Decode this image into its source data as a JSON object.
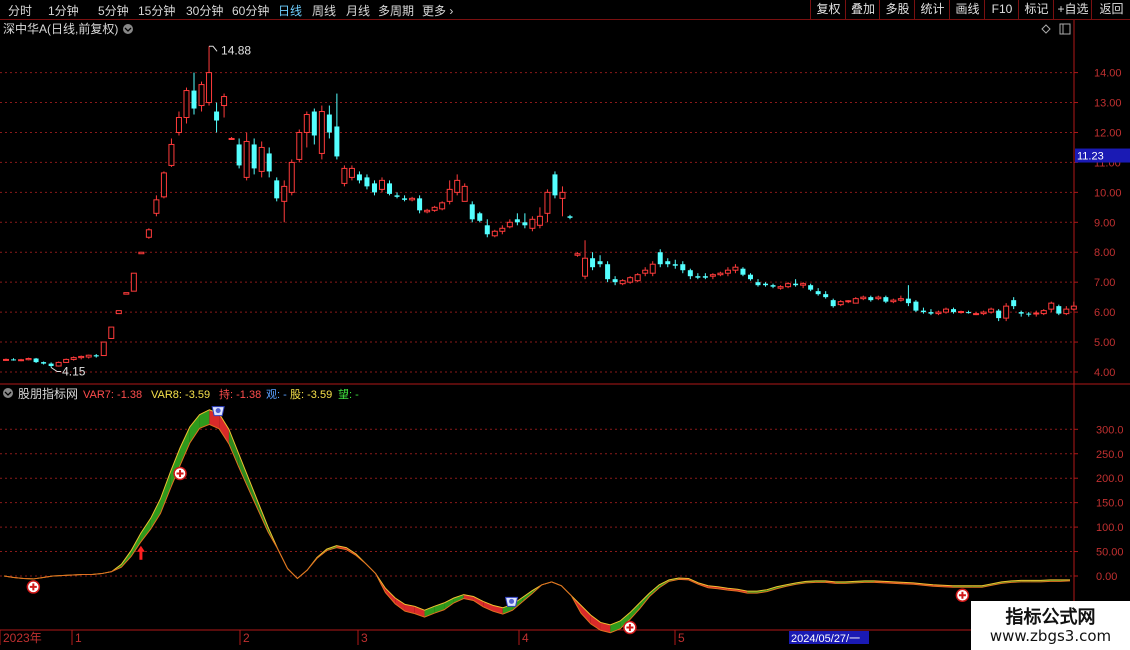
{
  "toolbar": {
    "periods": [
      "分时",
      "1分钟",
      "5分钟",
      "15分钟",
      "30分钟",
      "60分钟",
      "日线",
      "周线",
      "月线",
      "多周期",
      "更多"
    ],
    "active_period": "日线",
    "right_buttons": [
      "复权",
      "叠加",
      "多股",
      "统计",
      "画线",
      "F10",
      "标记",
      "+自选",
      "返回"
    ]
  },
  "main_chart": {
    "title": "深中华A(日线,前复权)",
    "high_label": "14.88",
    "low_label": "4.15",
    "current_price": "11.23",
    "y_ticks": [
      "14.00",
      "13.00",
      "12.00",
      "11.00",
      "10.00",
      "9.00",
      "8.00",
      "7.00",
      "6.00",
      "5.00",
      "4.00"
    ]
  },
  "indicator": {
    "name": "股朋指标网",
    "legend": [
      {
        "key": "VAR7",
        "value": "-1.38",
        "color": "#ff4d4d"
      },
      {
        "key": "VAR8",
        "value": "-3.59",
        "color": "#f5e04a"
      },
      {
        "key": "持",
        "value": "-1.38",
        "color": "#ff4d4d"
      },
      {
        "key": "观",
        "value": "-",
        "color": "#5aa0ff"
      },
      {
        "key": "股",
        "value": "-3.59",
        "color": "#f5e04a"
      },
      {
        "key": "望",
        "value": "-",
        "color": "#3ee03e"
      }
    ],
    "y_ticks": [
      "300.0",
      "250.0",
      "200.0",
      "150.0",
      "100.0",
      "50.00",
      "0.00"
    ]
  },
  "x_axis": {
    "labels": [
      "2023年",
      "1",
      "2",
      "3",
      "4",
      "5"
    ],
    "date_box": "2024/05/27/一"
  },
  "watermark": {
    "line1": "指标公式网",
    "line2": "www.zbgs3.com"
  },
  "colors": {
    "up": "#ff3b3b",
    "down": "#54ffff",
    "grid": "#8a1a1a",
    "axis": "#b01818"
  },
  "chart_data": {
    "type": "candlestick",
    "price_ylim": [
      3.8,
      15.0
    ],
    "indicator_ylim": [
      -105,
      360
    ],
    "candles": [
      {
        "i": 0,
        "o": 4.4,
        "h": 4.45,
        "l": 4.38,
        "c": 4.42
      },
      {
        "i": 1,
        "o": 4.42,
        "h": 4.46,
        "l": 4.38,
        "c": 4.4
      },
      {
        "i": 2,
        "o": 4.4,
        "h": 4.44,
        "l": 4.36,
        "c": 4.41
      },
      {
        "i": 3,
        "o": 4.41,
        "h": 4.48,
        "l": 4.39,
        "c": 4.45
      },
      {
        "i": 4,
        "o": 4.45,
        "h": 4.47,
        "l": 4.3,
        "c": 4.33
      },
      {
        "i": 5,
        "o": 4.33,
        "h": 4.35,
        "l": 4.25,
        "c": 4.28
      },
      {
        "i": 6,
        "o": 4.28,
        "h": 4.32,
        "l": 4.15,
        "c": 4.2
      },
      {
        "i": 7,
        "o": 4.2,
        "h": 4.35,
        "l": 4.18,
        "c": 4.32
      },
      {
        "i": 8,
        "o": 4.32,
        "h": 4.45,
        "l": 4.3,
        "c": 4.42
      },
      {
        "i": 9,
        "o": 4.42,
        "h": 4.52,
        "l": 4.38,
        "c": 4.48
      },
      {
        "i": 10,
        "o": 4.48,
        "h": 4.55,
        "l": 4.42,
        "c": 4.52
      },
      {
        "i": 11,
        "o": 4.5,
        "h": 4.58,
        "l": 4.45,
        "c": 4.56
      },
      {
        "i": 12,
        "o": 4.56,
        "h": 4.6,
        "l": 4.48,
        "c": 4.52
      },
      {
        "i": 13,
        "o": 4.55,
        "h": 5.0,
        "l": 4.55,
        "c": 5.0
      },
      {
        "i": 14,
        "o": 5.12,
        "h": 5.5,
        "l": 5.12,
        "c": 5.5
      },
      {
        "i": 15,
        "o": 5.95,
        "h": 6.05,
        "l": 5.95,
        "c": 6.05
      },
      {
        "i": 16,
        "o": 6.6,
        "h": 6.65,
        "l": 6.6,
        "c": 6.65
      },
      {
        "i": 17,
        "o": 6.7,
        "h": 7.3,
        "l": 6.7,
        "c": 7.3
      },
      {
        "i": 18,
        "o": 7.95,
        "h": 8.0,
        "l": 7.95,
        "c": 8.0
      },
      {
        "i": 19,
        "o": 8.5,
        "h": 8.8,
        "l": 8.45,
        "c": 8.75
      },
      {
        "i": 20,
        "o": 9.3,
        "h": 9.9,
        "l": 9.2,
        "c": 9.75
      },
      {
        "i": 21,
        "o": 9.85,
        "h": 10.7,
        "l": 9.8,
        "c": 10.65
      },
      {
        "i": 22,
        "o": 10.9,
        "h": 11.8,
        "l": 10.85,
        "c": 11.6
      },
      {
        "i": 23,
        "o": 12.0,
        "h": 12.7,
        "l": 11.9,
        "c": 12.5
      },
      {
        "i": 24,
        "o": 12.5,
        "h": 13.5,
        "l": 12.3,
        "c": 13.4
      },
      {
        "i": 25,
        "o": 13.4,
        "h": 14.0,
        "l": 12.6,
        "c": 12.8
      },
      {
        "i": 26,
        "o": 12.9,
        "h": 13.7,
        "l": 12.7,
        "c": 13.6
      },
      {
        "i": 27,
        "o": 13.0,
        "h": 14.88,
        "l": 12.9,
        "c": 14.0
      },
      {
        "i": 28,
        "o": 12.7,
        "h": 13.0,
        "l": 12.0,
        "c": 12.4
      },
      {
        "i": 29,
        "o": 12.9,
        "h": 13.3,
        "l": 12.5,
        "c": 13.2
      },
      {
        "i": 30,
        "o": 11.8,
        "h": 11.85,
        "l": 11.75,
        "c": 11.8
      },
      {
        "i": 31,
        "o": 11.6,
        "h": 11.8,
        "l": 10.8,
        "c": 10.9
      },
      {
        "i": 32,
        "o": 10.5,
        "h": 12.0,
        "l": 10.4,
        "c": 11.7
      },
      {
        "i": 33,
        "o": 11.6,
        "h": 11.8,
        "l": 10.6,
        "c": 10.8
      },
      {
        "i": 34,
        "o": 10.7,
        "h": 11.7,
        "l": 10.5,
        "c": 11.5
      },
      {
        "i": 35,
        "o": 11.3,
        "h": 11.5,
        "l": 10.5,
        "c": 10.7
      },
      {
        "i": 36,
        "o": 10.4,
        "h": 10.5,
        "l": 9.7,
        "c": 9.8
      },
      {
        "i": 37,
        "o": 9.7,
        "h": 10.4,
        "l": 9.0,
        "c": 10.2
      },
      {
        "i": 38,
        "o": 10.0,
        "h": 11.1,
        "l": 9.9,
        "c": 11.0
      },
      {
        "i": 39,
        "o": 11.1,
        "h": 12.1,
        "l": 11.0,
        "c": 12.0
      },
      {
        "i": 40,
        "o": 12.0,
        "h": 12.7,
        "l": 11.5,
        "c": 12.6
      },
      {
        "i": 41,
        "o": 12.7,
        "h": 12.8,
        "l": 11.6,
        "c": 11.9
      },
      {
        "i": 42,
        "o": 11.3,
        "h": 12.9,
        "l": 11.1,
        "c": 12.7
      },
      {
        "i": 43,
        "o": 12.6,
        "h": 12.9,
        "l": 11.8,
        "c": 12.0
      },
      {
        "i": 44,
        "o": 12.2,
        "h": 13.3,
        "l": 11.1,
        "c": 11.2
      },
      {
        "i": 45,
        "o": 10.3,
        "h": 10.9,
        "l": 10.2,
        "c": 10.8
      },
      {
        "i": 46,
        "o": 10.5,
        "h": 10.9,
        "l": 10.4,
        "c": 10.8
      },
      {
        "i": 47,
        "o": 10.6,
        "h": 10.7,
        "l": 10.3,
        "c": 10.4
      },
      {
        "i": 48,
        "o": 10.5,
        "h": 10.6,
        "l": 10.1,
        "c": 10.2
      },
      {
        "i": 49,
        "o": 10.3,
        "h": 10.4,
        "l": 9.9,
        "c": 10.0
      },
      {
        "i": 50,
        "o": 10.1,
        "h": 10.5,
        "l": 10.0,
        "c": 10.4
      },
      {
        "i": 51,
        "o": 10.3,
        "h": 10.4,
        "l": 9.9,
        "c": 9.95
      },
      {
        "i": 52,
        "o": 9.9,
        "h": 10.0,
        "l": 9.8,
        "c": 9.85
      },
      {
        "i": 53,
        "o": 9.8,
        "h": 9.9,
        "l": 9.7,
        "c": 9.75
      },
      {
        "i": 54,
        "o": 9.75,
        "h": 9.85,
        "l": 9.7,
        "c": 9.8
      },
      {
        "i": 55,
        "o": 9.8,
        "h": 9.9,
        "l": 9.3,
        "c": 9.4
      },
      {
        "i": 56,
        "o": 9.35,
        "h": 9.45,
        "l": 9.3,
        "c": 9.4
      },
      {
        "i": 57,
        "o": 9.4,
        "h": 9.55,
        "l": 9.35,
        "c": 9.5
      },
      {
        "i": 58,
        "o": 9.45,
        "h": 9.7,
        "l": 9.4,
        "c": 9.65
      },
      {
        "i": 59,
        "o": 9.7,
        "h": 10.4,
        "l": 9.6,
        "c": 10.1
      },
      {
        "i": 60,
        "o": 10.0,
        "h": 10.6,
        "l": 9.9,
        "c": 10.4
      },
      {
        "i": 61,
        "o": 9.7,
        "h": 10.3,
        "l": 9.7,
        "c": 10.2
      },
      {
        "i": 62,
        "o": 9.6,
        "h": 9.7,
        "l": 9.0,
        "c": 9.1
      },
      {
        "i": 63,
        "o": 9.3,
        "h": 9.35,
        "l": 9.0,
        "c": 9.05
      },
      {
        "i": 64,
        "o": 8.9,
        "h": 9.1,
        "l": 8.5,
        "c": 8.6
      },
      {
        "i": 65,
        "o": 8.55,
        "h": 8.75,
        "l": 8.5,
        "c": 8.7
      },
      {
        "i": 66,
        "o": 8.7,
        "h": 8.9,
        "l": 8.6,
        "c": 8.8
      },
      {
        "i": 67,
        "o": 8.85,
        "h": 9.1,
        "l": 8.8,
        "c": 9.0
      },
      {
        "i": 68,
        "o": 9.1,
        "h": 9.3,
        "l": 8.9,
        "c": 9.0
      },
      {
        "i": 69,
        "o": 9.0,
        "h": 9.3,
        "l": 8.8,
        "c": 8.9
      },
      {
        "i": 70,
        "o": 8.8,
        "h": 9.2,
        "l": 8.7,
        "c": 9.1
      },
      {
        "i": 71,
        "o": 8.9,
        "h": 9.5,
        "l": 8.8,
        "c": 9.2
      },
      {
        "i": 72,
        "o": 9.3,
        "h": 10.1,
        "l": 9.0,
        "c": 10.0
      },
      {
        "i": 73,
        "o": 10.6,
        "h": 10.7,
        "l": 9.8,
        "c": 9.9
      },
      {
        "i": 74,
        "o": 9.8,
        "h": 10.2,
        "l": 9.2,
        "c": 10.0
      },
      {
        "i": 75,
        "o": 9.2,
        "h": 9.25,
        "l": 9.1,
        "c": 9.15
      },
      {
        "i": 76,
        "o": 7.9,
        "h": 8.0,
        "l": 7.85,
        "c": 7.95
      },
      {
        "i": 77,
        "o": 7.2,
        "h": 8.4,
        "l": 7.1,
        "c": 7.8
      },
      {
        "i": 78,
        "o": 7.8,
        "h": 8.0,
        "l": 7.4,
        "c": 7.5
      },
      {
        "i": 79,
        "o": 7.7,
        "h": 7.9,
        "l": 7.5,
        "c": 7.6
      },
      {
        "i": 80,
        "o": 7.6,
        "h": 7.7,
        "l": 7.0,
        "c": 7.1
      },
      {
        "i": 81,
        "o": 7.1,
        "h": 7.2,
        "l": 6.9,
        "c": 7.0
      },
      {
        "i": 82,
        "o": 6.95,
        "h": 7.1,
        "l": 6.9,
        "c": 7.05
      },
      {
        "i": 83,
        "o": 7.0,
        "h": 7.2,
        "l": 6.95,
        "c": 7.15
      },
      {
        "i": 84,
        "o": 7.05,
        "h": 7.3,
        "l": 7.0,
        "c": 7.25
      },
      {
        "i": 85,
        "o": 7.3,
        "h": 7.5,
        "l": 7.2,
        "c": 7.4
      },
      {
        "i": 86,
        "o": 7.3,
        "h": 7.7,
        "l": 7.2,
        "c": 7.6
      },
      {
        "i": 87,
        "o": 8.0,
        "h": 8.1,
        "l": 7.5,
        "c": 7.6
      },
      {
        "i": 88,
        "o": 7.7,
        "h": 7.8,
        "l": 7.5,
        "c": 7.6
      },
      {
        "i": 89,
        "o": 7.6,
        "h": 7.75,
        "l": 7.45,
        "c": 7.55
      },
      {
        "i": 90,
        "o": 7.6,
        "h": 7.7,
        "l": 7.3,
        "c": 7.4
      },
      {
        "i": 91,
        "o": 7.4,
        "h": 7.45,
        "l": 7.1,
        "c": 7.2
      },
      {
        "i": 92,
        "o": 7.2,
        "h": 7.3,
        "l": 7.1,
        "c": 7.15
      },
      {
        "i": 93,
        "o": 7.2,
        "h": 7.3,
        "l": 7.1,
        "c": 7.15
      },
      {
        "i": 94,
        "o": 7.2,
        "h": 7.3,
        "l": 7.1,
        "c": 7.25
      },
      {
        "i": 95,
        "o": 7.25,
        "h": 7.35,
        "l": 7.2,
        "c": 7.3
      },
      {
        "i": 96,
        "o": 7.3,
        "h": 7.5,
        "l": 7.2,
        "c": 7.4
      },
      {
        "i": 97,
        "o": 7.4,
        "h": 7.6,
        "l": 7.3,
        "c": 7.5
      },
      {
        "i": 98,
        "o": 7.45,
        "h": 7.5,
        "l": 7.2,
        "c": 7.25
      },
      {
        "i": 99,
        "o": 7.25,
        "h": 7.3,
        "l": 7.05,
        "c": 7.1
      },
      {
        "i": 100,
        "o": 7.0,
        "h": 7.1,
        "l": 6.85,
        "c": 6.9
      },
      {
        "i": 101,
        "o": 6.95,
        "h": 7.0,
        "l": 6.85,
        "c": 6.9
      },
      {
        "i": 102,
        "o": 6.9,
        "h": 6.95,
        "l": 6.8,
        "c": 6.85
      },
      {
        "i": 103,
        "o": 6.8,
        "h": 6.9,
        "l": 6.75,
        "c": 6.85
      },
      {
        "i": 104,
        "o": 6.85,
        "h": 7.0,
        "l": 6.8,
        "c": 6.95
      },
      {
        "i": 105,
        "o": 6.95,
        "h": 7.1,
        "l": 6.85,
        "c": 6.9
      },
      {
        "i": 106,
        "o": 6.9,
        "h": 7.0,
        "l": 6.8,
        "c": 6.95
      },
      {
        "i": 107,
        "o": 6.9,
        "h": 6.95,
        "l": 6.7,
        "c": 6.75
      },
      {
        "i": 108,
        "o": 6.7,
        "h": 6.8,
        "l": 6.55,
        "c": 6.6
      },
      {
        "i": 109,
        "o": 6.6,
        "h": 6.7,
        "l": 6.45,
        "c": 6.5
      },
      {
        "i": 110,
        "o": 6.4,
        "h": 6.45,
        "l": 6.15,
        "c": 6.2
      },
      {
        "i": 111,
        "o": 6.25,
        "h": 6.4,
        "l": 6.2,
        "c": 6.35
      },
      {
        "i": 112,
        "o": 6.35,
        "h": 6.4,
        "l": 6.3,
        "c": 6.38
      },
      {
        "i": 113,
        "o": 6.3,
        "h": 6.5,
        "l": 6.3,
        "c": 6.45
      },
      {
        "i": 114,
        "o": 6.45,
        "h": 6.55,
        "l": 6.4,
        "c": 6.5
      },
      {
        "i": 115,
        "o": 6.5,
        "h": 6.55,
        "l": 6.35,
        "c": 6.4
      },
      {
        "i": 116,
        "o": 6.45,
        "h": 6.55,
        "l": 6.4,
        "c": 6.5
      },
      {
        "i": 117,
        "o": 6.5,
        "h": 6.55,
        "l": 6.3,
        "c": 6.35
      },
      {
        "i": 118,
        "o": 6.35,
        "h": 6.45,
        "l": 6.3,
        "c": 6.4
      },
      {
        "i": 119,
        "o": 6.4,
        "h": 6.55,
        "l": 6.35,
        "c": 6.45
      },
      {
        "i": 120,
        "o": 6.45,
        "h": 6.9,
        "l": 6.2,
        "c": 6.3
      },
      {
        "i": 121,
        "o": 6.35,
        "h": 6.4,
        "l": 6.0,
        "c": 6.05
      },
      {
        "i": 122,
        "o": 6.05,
        "h": 6.15,
        "l": 5.95,
        "c": 6.0
      },
      {
        "i": 123,
        "o": 6.0,
        "h": 6.1,
        "l": 5.9,
        "c": 5.95
      },
      {
        "i": 124,
        "o": 5.95,
        "h": 6.05,
        "l": 5.9,
        "c": 6.0
      },
      {
        "i": 125,
        "o": 6.0,
        "h": 6.15,
        "l": 5.95,
        "c": 6.1
      },
      {
        "i": 126,
        "o": 6.1,
        "h": 6.15,
        "l": 5.95,
        "c": 6.0
      },
      {
        "i": 127,
        "o": 6.0,
        "h": 6.05,
        "l": 5.95,
        "c": 6.02
      },
      {
        "i": 128,
        "o": 6.0,
        "h": 6.05,
        "l": 5.95,
        "c": 5.98
      },
      {
        "i": 129,
        "o": 5.95,
        "h": 6.0,
        "l": 5.9,
        "c": 5.95
      },
      {
        "i": 130,
        "o": 5.95,
        "h": 6.05,
        "l": 5.9,
        "c": 6.0
      },
      {
        "i": 131,
        "o": 6.0,
        "h": 6.15,
        "l": 5.95,
        "c": 6.1
      },
      {
        "i": 132,
        "o": 6.05,
        "h": 6.1,
        "l": 5.7,
        "c": 5.8
      },
      {
        "i": 133,
        "o": 5.8,
        "h": 6.3,
        "l": 5.7,
        "c": 6.2
      },
      {
        "i": 134,
        "o": 6.4,
        "h": 6.5,
        "l": 6.1,
        "c": 6.2
      },
      {
        "i": 135,
        "o": 6.0,
        "h": 6.05,
        "l": 5.85,
        "c": 5.95
      },
      {
        "i": 136,
        "o": 5.95,
        "h": 6.0,
        "l": 5.85,
        "c": 5.92
      },
      {
        "i": 137,
        "o": 5.95,
        "h": 6.05,
        "l": 5.85,
        "c": 5.97
      },
      {
        "i": 138,
        "o": 5.95,
        "h": 6.1,
        "l": 5.9,
        "c": 6.05
      },
      {
        "i": 139,
        "o": 6.1,
        "h": 6.35,
        "l": 6.0,
        "c": 6.3
      },
      {
        "i": 140,
        "o": 6.2,
        "h": 6.25,
        "l": 5.9,
        "c": 5.95
      },
      {
        "i": 141,
        "o": 5.95,
        "h": 6.2,
        "l": 5.9,
        "c": 6.1
      },
      {
        "i": 142,
        "o": 6.1,
        "h": 6.35,
        "l": 6.05,
        "c": 6.2
      }
    ],
    "indicator_upper": [
      0,
      -3,
      -5,
      -6,
      -3,
      0,
      1,
      2,
      3,
      3,
      5,
      9,
      24,
      52,
      88,
      118,
      158,
      212,
      262,
      305,
      330,
      340,
      332,
      300,
      250,
      200,
      150,
      100,
      55,
      15,
      -5,
      12,
      38,
      55,
      62,
      58,
      45,
      25,
      5,
      -25,
      -45,
      -58,
      -62,
      -70,
      -62,
      -55,
      -45,
      -38,
      -42,
      -52,
      -60,
      -65,
      -58,
      -44,
      -30,
      -18,
      -12,
      -20,
      -40,
      -60,
      -80,
      -95,
      -100,
      -92,
      -75,
      -55,
      -35,
      -18,
      -8,
      -4,
      -5,
      -14,
      -20,
      -22,
      -25,
      -27,
      -31,
      -31,
      -28,
      -22,
      -18,
      -14,
      -11,
      -10,
      -10,
      -12,
      -12,
      -11,
      -10,
      -10,
      -11,
      -12,
      -13,
      -14,
      -16,
      -18,
      -19,
      -20,
      -20,
      -20,
      -20,
      -16,
      -12,
      -10,
      -9,
      -9,
      -9,
      -8,
      -8,
      -8
    ],
    "indicator_lower": [
      0,
      -3,
      -5,
      -6,
      -3,
      0,
      1,
      2,
      3,
      3,
      5,
      9,
      18,
      40,
      70,
      96,
      128,
      178,
      226,
      272,
      302,
      310,
      301,
      270,
      223,
      178,
      134,
      90,
      55,
      15,
      -5,
      12,
      36,
      52,
      58,
      54,
      42,
      25,
      5,
      -34,
      -57,
      -72,
      -77,
      -84,
      -76,
      -69,
      -55,
      -46,
      -50,
      -63,
      -72,
      -78,
      -70,
      -53,
      -36,
      -18,
      -12,
      -20,
      -40,
      -76,
      -98,
      -111,
      -116,
      -108,
      -89,
      -67,
      -42,
      -24,
      -11,
      -7,
      -8,
      -17,
      -24,
      -26,
      -29,
      -31,
      -35,
      -35,
      -32,
      -26,
      -21,
      -17,
      -14,
      -13,
      -13,
      -15,
      -15,
      -14,
      -13,
      -13,
      -14,
      -15,
      -16,
      -17,
      -19,
      -21,
      -22,
      -23,
      -23,
      -23,
      -23,
      -19,
      -15,
      -13,
      -12,
      -12,
      -12,
      -11,
      -11,
      -10
    ],
    "signal_plus_at": [
      3,
      18,
      64,
      98
    ],
    "signal_cup_at": [
      22,
      52
    ],
    "signal_arrow_at": [
      14
    ]
  }
}
